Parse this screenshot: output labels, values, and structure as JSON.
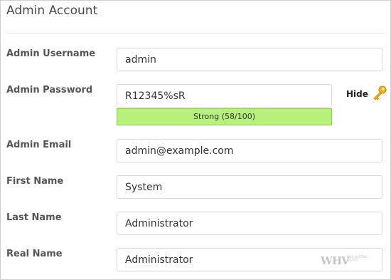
{
  "section": {
    "title": "Admin Account"
  },
  "fields": {
    "username": {
      "label": "Admin Username",
      "value": "admin"
    },
    "password": {
      "label": "Admin Password",
      "value": "R12345%sR",
      "strength_text": "Strong (58/100)",
      "toggle_label": "Hide",
      "strength_color": "#b8f07e"
    },
    "email": {
      "label": "Admin Email",
      "value": "admin@example.com"
    },
    "first_name": {
      "label": "First Name",
      "value": "System"
    },
    "last_name": {
      "label": "Last Name",
      "value": "Administrator"
    },
    "real_name": {
      "label": "Real Name",
      "value": "Administrator"
    }
  },
  "watermark": {
    "mark": "WHV",
    "sub": "WEB HOSTING VALUES"
  },
  "icons": {
    "password_toggle": "key-icon"
  }
}
